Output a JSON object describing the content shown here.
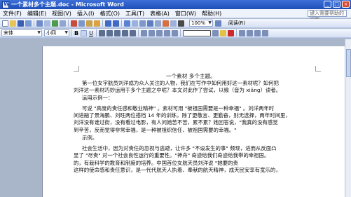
{
  "window": {
    "title": "一个素材多个主题.doc - Microsoft Word",
    "controls": [
      "_",
      "□",
      "×"
    ]
  },
  "menu": {
    "items": [
      "文件(F)",
      "编辑(E)",
      "视图(V)",
      "插入(I)",
      "格式(O)",
      "工具(T)",
      "表格(A)",
      "窗口(W)",
      "帮助(H)"
    ],
    "help_placeholder": "键入需要帮助的问题"
  },
  "toolbar": {
    "zoom": "100%",
    "style_value": "",
    "font_value": "宋体",
    "font_size": "小四",
    "bold": "B",
    "underline": "U",
    "read_label": "阅读(R)"
  },
  "document": {
    "title": "一个素材 多个主题。",
    "lines": [
      "第一位女字航员刘洋成为众人关注的人物，我们在写作中如何用好这一素材呢？如何把",
      "刘洋这一素材巧妙运用于多个主题之中呢？本文对此作了尝试，以飨（音为 xiǎng）读者。",
      "运用示例一：",
      "可说 \"高度的责任感和敬业精神\" 。素材可用 \"被祖国需要是一种幸福\" 。刘洋两年时",
      "间进融了景海鹏、刘旺两位搭档 14 年的训练，除了更敬言、更勤奋，别无选择，两年时间里，",
      "刘洋没有谁过街，没有看过电影，有人问她苦不苦，累不累？她回答说，\"我真的没有感觉",
      "到辛苦，反而觉得非常幸福，是一种被祖织信任、被祖国需要的幸福。\"",
      "示例。",
      "社会生活中，因为对责任的忽视与逃避，让许多 \"不设发生的事\" 频现，进而从反面凸",
      "显了 \"尽责\" 对一个社会良性运行的重要性。\"神舟\" 奇迹给我们奇迹给我带的幸祖国。",
      "的，有栽科学的教育和制度的培养。中国首位女航天员刘洋说 \"她要的责",
      "这样的使命感和责任意识，是一代代航天人执着、奉献的航天精神，成天民安享有宽乐的，"
    ]
  }
}
